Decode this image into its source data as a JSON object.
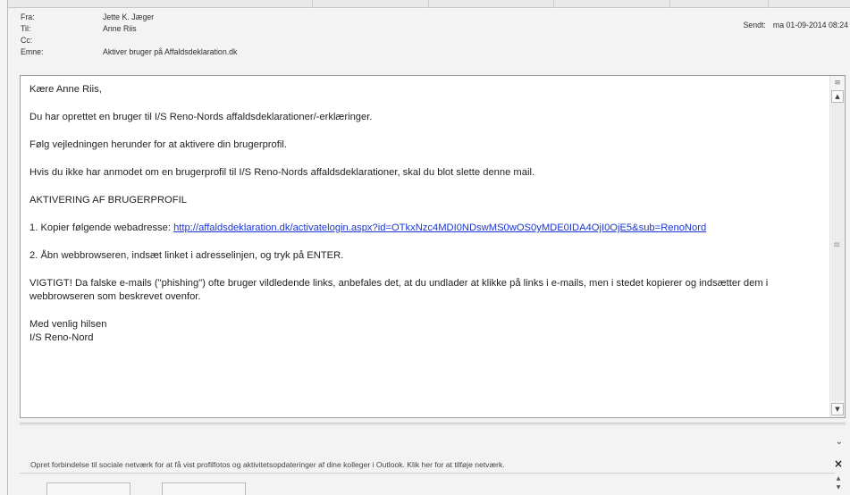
{
  "header": {
    "from_label": "Fra:",
    "from_value": "Jette K. Jæger",
    "to_label": "Til:",
    "to_value": "Anne Riis",
    "cc_label": "Cc:",
    "cc_value": "",
    "subject_label": "Emne:",
    "subject_value": "Aktiver bruger på Affaldsdeklaration.dk",
    "sent_label": "Sendt:",
    "sent_value": "ma 01-09-2014 08:24"
  },
  "message": {
    "greeting": "Kære Anne Riis,",
    "p1": "Du har oprettet en bruger til I/S Reno-Nords affaldsdeklarationer/-erklæringer.",
    "p2": "Følg vejledningen herunder for at aktivere din brugerprofil.",
    "p3": "Hvis du ikke har anmodet om en brugerprofil til I/S Reno-Nords  affaldsdeklarationer, skal du blot slette denne mail.",
    "heading": "AKTIVERING AF BRUGERPROFIL",
    "step1_prefix": "1. Kopier følgende webadresse: ",
    "step1_link": "http://affaldsdeklaration.dk/activatelogin.aspx?id=OTkxNzc4MDI0NDswMS0wOS0yMDE0IDA4OjI0OjE5&sub=RenoNord",
    "step2": "2. Åbn webbrowseren, indsæt linket i adresselinjen, og tryk på ENTER.",
    "warning": "VIGTIGT! Da falske e-mails (\"phishing\") ofte bruger vildledende links, anbefales det, at du undlader at klikke på links i e-mails, men i stedet kopierer og indsætter dem i webbrowseren som beskrevet ovenfor.",
    "closing": "Med venlig hilsen",
    "signature": "I/S Reno-Nord"
  },
  "social_bar": {
    "text": "Opret forbindelse til sociale netværk for at få vist profilfotos og aktivitetsopdateringer af dine kolleger i Outlook. Klik her for at tilføje netværk.",
    "close_glyph": "×"
  },
  "icons": {
    "expand": "chevron-down-icon",
    "scroll_up": "arrow-up-icon",
    "scroll_down": "arrow-down-icon"
  }
}
